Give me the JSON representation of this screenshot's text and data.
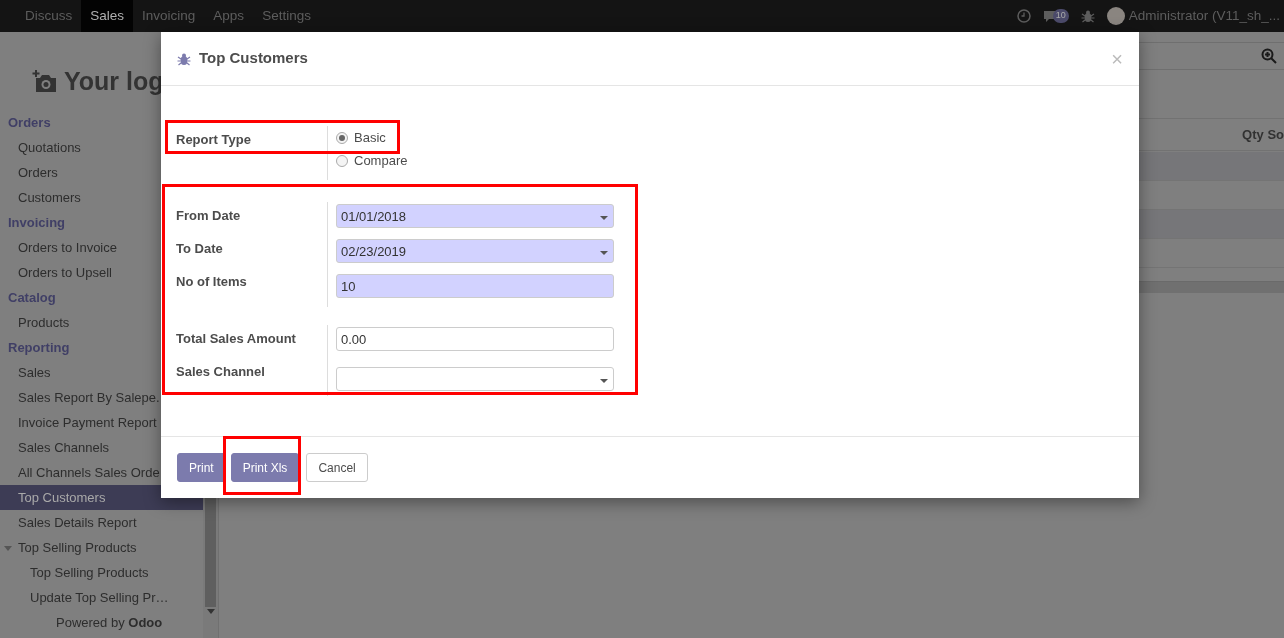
{
  "top_menu": [
    {
      "label": "Discuss",
      "selected": false
    },
    {
      "label": "Sales",
      "selected": true
    },
    {
      "label": "Invoicing",
      "selected": false
    },
    {
      "label": "Apps",
      "selected": false
    },
    {
      "label": "Settings",
      "selected": false
    }
  ],
  "systray": {
    "messages_badge": "10",
    "user": "Administrator (V11_sh_..."
  },
  "sidebar": {
    "logo_text": "Your log",
    "sections": [
      {
        "title": "Orders",
        "items": [
          {
            "label": "Quotations",
            "selected": false,
            "kind": "link"
          },
          {
            "label": "Orders",
            "selected": false,
            "kind": "link"
          },
          {
            "label": "Customers",
            "selected": false,
            "kind": "link"
          }
        ]
      },
      {
        "title": "Invoicing",
        "items": [
          {
            "label": "Orders to Invoice",
            "selected": false,
            "kind": "link"
          },
          {
            "label": "Orders to Upsell",
            "selected": false,
            "kind": "link"
          }
        ]
      },
      {
        "title": "Catalog",
        "items": [
          {
            "label": "Products",
            "selected": false,
            "kind": "link"
          }
        ]
      },
      {
        "title": "Reporting",
        "items": [
          {
            "label": "Sales",
            "selected": false,
            "kind": "link"
          },
          {
            "label": "Sales Report By Salepe.",
            "selected": false,
            "kind": "link"
          },
          {
            "label": "Invoice Payment Report",
            "selected": false,
            "kind": "link"
          },
          {
            "label": "Sales Channels",
            "selected": false,
            "kind": "link"
          },
          {
            "label": "All Channels Sales Orde",
            "selected": false,
            "kind": "link"
          },
          {
            "label": "Top Customers",
            "selected": true,
            "kind": "link"
          },
          {
            "label": "Sales Details Report",
            "selected": false,
            "kind": "link"
          },
          {
            "label": "Top Selling Products",
            "selected": false,
            "kind": "group",
            "expanded": true,
            "children": [
              {
                "label": "Top Selling Products",
                "selected": false,
                "kind": "link"
              },
              {
                "label": "Update Top Selling Pr…",
                "selected": false,
                "kind": "link"
              }
            ]
          }
        ]
      }
    ],
    "footer": "Powered by **Odoo**"
  },
  "background_table": {
    "columns": [
      "Qty So"
    ]
  },
  "dialog": {
    "title": "Top Customers",
    "close": "×",
    "groups": [
      [
        {
          "label": "Report Type",
          "kind": "radio",
          "options": [
            {
              "label": "Basic",
              "selected": true
            },
            {
              "label": "Compare",
              "selected": false
            }
          ]
        }
      ],
      [
        {
          "label": "From Date",
          "kind": "date",
          "value": "01/01/2018",
          "required": true
        },
        {
          "label": "To Date",
          "kind": "date",
          "value": "02/23/2019",
          "required": true
        },
        {
          "label": "No of Items",
          "kind": "text",
          "value": "10",
          "required": true
        }
      ],
      [
        {
          "label": "Total Sales Amount",
          "kind": "text",
          "value": "0.00",
          "required": false
        },
        {
          "label": "Sales Channel",
          "kind": "select",
          "required": false
        }
      ]
    ],
    "buttons": [
      {
        "label": "Print",
        "primary": true
      },
      {
        "label": "Print Xls",
        "primary": true
      },
      {
        "label": "Cancel",
        "primary": false
      }
    ]
  }
}
